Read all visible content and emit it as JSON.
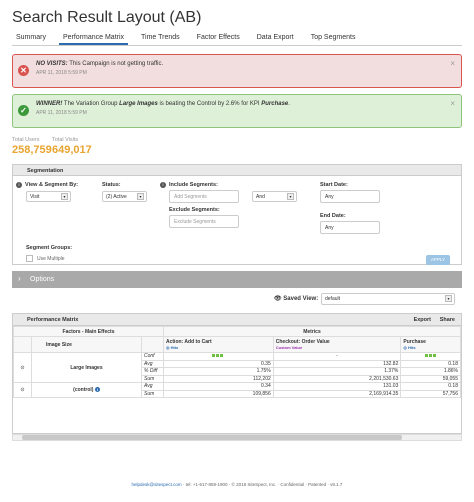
{
  "page": {
    "title": "Search Result Layout (AB)"
  },
  "tabs": [
    "Summary",
    "Performance Matrix",
    "Time Trends",
    "Factor Effects",
    "Data Export",
    "Top Segments"
  ],
  "alerts": {
    "red": {
      "head": "NO VISITS:",
      "text": " This Campaign is not getting traffic.",
      "date": "APR 11, 2018 5:59 PM",
      "close": "×"
    },
    "green": {
      "head": "WINNER!",
      "text_a": " The Variation Group ",
      "group": "Large Images",
      "text_b": " is beating the Control by 2.6% for KPI ",
      "kpi": "Purchase",
      "text_c": ".",
      "date": "APR 11, 2018 5:59 PM",
      "close": "×"
    }
  },
  "stats": {
    "total_users_label": "Total Users",
    "total_users": "258,759",
    "total_visits_label": "Total Visits",
    "total_visits": "649,017"
  },
  "segmentation": {
    "heading": "Segmentation",
    "view_label": "View & Segment By:",
    "view_value": "Visit",
    "status_label": "Status:",
    "status_value": "(2) Active",
    "include_label": "Include Segments:",
    "include_placeholder": "Add Segments",
    "and_value": "And",
    "exclude_label": "Exclude Segments:",
    "exclude_placeholder": "Exclude Segments",
    "start_label": "Start Date:",
    "start_value": "Any",
    "end_label": "End Date:",
    "end_value": "Any",
    "groups_label": "Segment Groups:",
    "use_multiple": "Use Multiple",
    "apply": "APPLY"
  },
  "options": {
    "label": "Options"
  },
  "saved_view": {
    "label": "Saved View:",
    "value": "default"
  },
  "matrix": {
    "heading": "Performance Matrix",
    "export": "Export",
    "share": "Share",
    "factors_header": "Factors - Main Effects",
    "metrics_header": "Metrics",
    "factor_col": "Image Size",
    "metric_cols": [
      {
        "name": "Action: Add to Cart",
        "sub": "Hits"
      },
      {
        "name": "Checkout: Order Value",
        "sub": "Custom Value"
      },
      {
        "name": "Purchase",
        "sub": "Hits"
      }
    ],
    "rows": [
      {
        "variation": "Large Images",
        "stats": [
          {
            "label": "Conf",
            "values": [
              "",
              "-",
              ""
            ]
          },
          {
            "label": "Avg",
            "values": [
              "0.35",
              "132.82",
              "0.18"
            ]
          },
          {
            "label": "% Diff",
            "values": [
              "1.75%",
              "1.37%",
              "1.86%"
            ]
          },
          {
            "label": "Sum",
            "values": [
              "112,202",
              "2,201,530.63",
              "59,055"
            ]
          }
        ]
      },
      {
        "variation": "(control)",
        "stats": [
          {
            "label": "Avg",
            "values": [
              "0.34",
              "131.03",
              "0.18"
            ]
          },
          {
            "label": "Sum",
            "values": [
              "109,856",
              "2,169,914.35",
              "57,756"
            ]
          }
        ]
      }
    ]
  },
  "footer": {
    "email": "helpdesk@sitespect.com",
    "rest": "· tel: +1-617-859-1900 · © 2018 SiteSpect, Inc. · Confidential · Patented · v8.1.7"
  },
  "colors": {
    "accent": "#2b6cb0",
    "highlight": "#e8a430",
    "alert_red": "#d9534f",
    "alert_green": "#3c9a3c"
  }
}
